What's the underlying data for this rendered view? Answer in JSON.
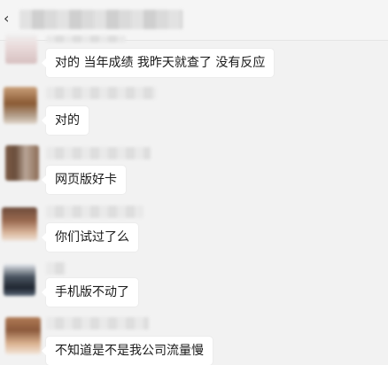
{
  "header": {
    "back_icon": "‹"
  },
  "messages": [
    {
      "text": "对的  当年成绩 我昨天就查了 没有反应"
    },
    {
      "text": "对的"
    },
    {
      "text": "网页版好卡"
    },
    {
      "text": "你们试过了么"
    },
    {
      "text": "手机版不动了"
    },
    {
      "text": "不知道是不是我公司流量慢"
    }
  ]
}
